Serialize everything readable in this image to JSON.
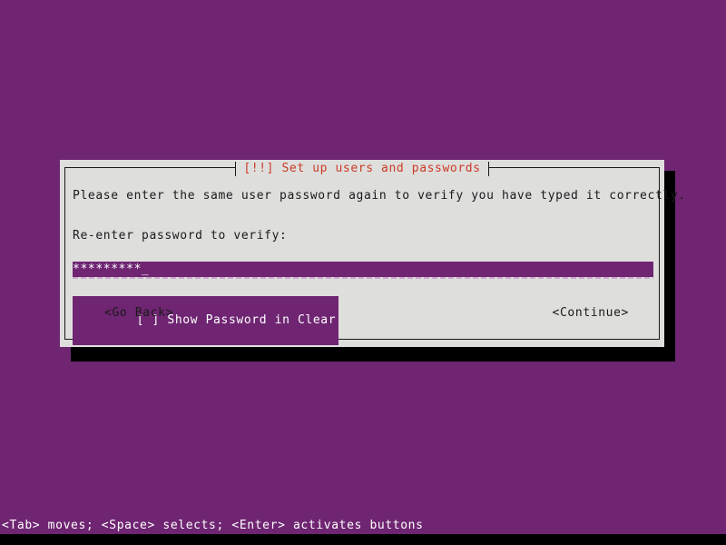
{
  "screen": {
    "background_color": "#6f2572",
    "text_color": "#ffffff"
  },
  "dialog": {
    "title": "[!!] Set up users and passwords",
    "title_color": "#cc3b25",
    "background_color": "#dededd",
    "border_color": "#1a1a1a",
    "shadow_color": "#000000",
    "prompt_main": "Please enter the same user password again to verify you have typed it correctly.",
    "prompt_label": "Re-enter password to verify:"
  },
  "password_field": {
    "name": "password-input",
    "masked_value": "*********",
    "cursor": "_",
    "placeholder": "",
    "field_background_color": "#6f2572",
    "field_text_color": "#ffffff",
    "underline_color": "#c9a9cc",
    "focused": true
  },
  "checkbox": {
    "marker": "[ ]",
    "label": "Show Password in Clear",
    "checked": false,
    "selected": true,
    "selected_background_color": "#6f2572",
    "selected_text_color": "#ffffff"
  },
  "buttons": {
    "go_back": "<Go Back>",
    "continue": "<Continue>"
  },
  "status_bar": {
    "help_text": "<Tab> moves; <Space> selects; <Enter> activates buttons"
  }
}
